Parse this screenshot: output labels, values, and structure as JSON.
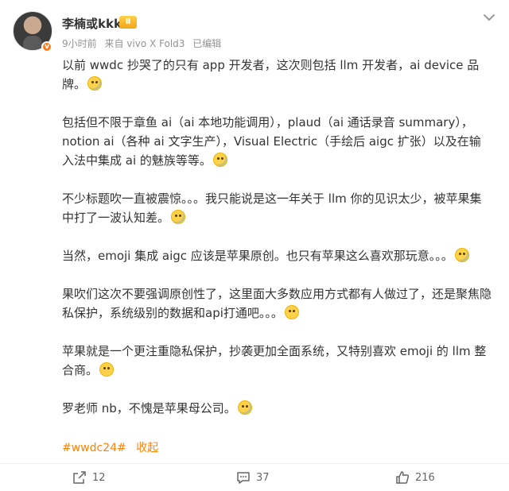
{
  "post": {
    "author": "李楠或kkk",
    "level_badge": "Ⅱ",
    "verify_mark": "v",
    "time": "9小时前",
    "source": "来自 vivo X Fold3",
    "edited": "已编辑",
    "paragraphs": [
      "以前 wwdc 抄哭了的只有 app 开发者，这次则包括 llm 开发者，ai device 品牌。",
      "包括但不限于章鱼 ai（ai 本地功能调用），plaud（ai 通话录音 summary），notion ai（各种 ai 文字生产），Visual Electric（手绘后 aigc 扩张）以及在输入法中集成 ai 的魅族等等。",
      "不少标题吹一直被震惊。。。我只能说是这一年关于 llm 你的见识太少，被苹果集中打了一波认知差。",
      "当然，emoji 集成 aigc 应该是苹果原创。也只有苹果这么喜欢那玩意。。。",
      "果吹们这次不要强调原创性了，这里面大多数应用方式都有人做过了，还是聚焦隐私保护，系统级别的数据和api打通吧。。。",
      "苹果就是一个更注重隐私保护，抄袭更加全面系统，又特别喜欢 emoji 的 llm 整合商。",
      "罗老师 nb，不愧是苹果母公司。"
    ],
    "hashtag": "#wwdc24#",
    "collapse_label": "收起"
  },
  "actions": {
    "share_count": "12",
    "comment_count": "37",
    "like_count": "216"
  },
  "icons": {
    "menu": "chevron-down-icon",
    "share": "share-icon",
    "comment": "comment-icon",
    "like": "thumbs-up-icon",
    "emoji": "emoji-icon"
  },
  "colors": {
    "accent": "#ff8200",
    "meta": "#939393",
    "text": "#333333"
  }
}
